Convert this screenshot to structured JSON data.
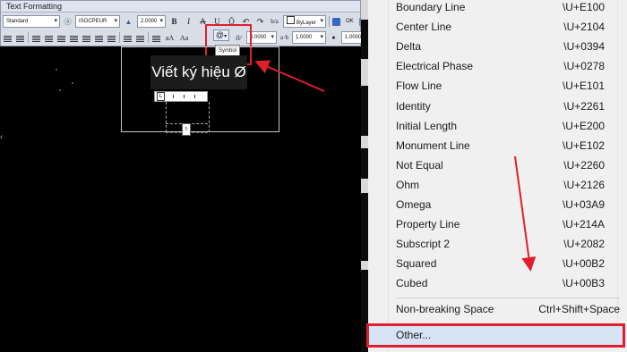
{
  "toolbar": {
    "title": "Text Formatting",
    "style": "Standard",
    "font": "ISOCPEUR",
    "height": "2.0000",
    "bold": "B",
    "italic": "I",
    "strike": "A",
    "underline": "U",
    "overline": "Ō",
    "color": "ByLayer",
    "ok": "OK",
    "symbol_glyph": "@",
    "oblique_value": "0.0000",
    "tracking_value": "1.0000",
    "width_value": "1.0000",
    "oblique_glyph": "0/",
    "tracking_glyph": "a·b",
    "width_glyph": "●"
  },
  "tooltip": "Symbol",
  "canvas": {
    "mtext": "Viết ký hiệu Ø",
    "ruler_tab": "L",
    "grip": "◊"
  },
  "menu": {
    "items": [
      {
        "label": "Boundary Line",
        "code": "\\U+E100"
      },
      {
        "label": "Center Line",
        "code": "\\U+2104"
      },
      {
        "label": "Delta",
        "code": "\\U+0394"
      },
      {
        "label": "Electrical Phase",
        "code": "\\U+0278"
      },
      {
        "label": "Flow Line",
        "code": "\\U+E101"
      },
      {
        "label": "Identity",
        "code": "\\U+2261"
      },
      {
        "label": "Initial Length",
        "code": "\\U+E200"
      },
      {
        "label": "Monument Line",
        "code": "\\U+E102"
      },
      {
        "label": "Not Equal",
        "code": "\\U+2260"
      },
      {
        "label": "Ohm",
        "code": "\\U+2126"
      },
      {
        "label": "Omega",
        "code": "\\U+03A9"
      },
      {
        "label": "Property Line",
        "code": "\\U+214A"
      },
      {
        "label": "Subscript 2",
        "code": "\\U+2082"
      },
      {
        "label": "Squared",
        "code": "\\U+00B2"
      },
      {
        "label": "Cubed",
        "code": "\\U+00B3"
      }
    ],
    "nbsp": {
      "label": "Non-breaking Space",
      "code": "Ctrl+Shift+Space"
    },
    "other": "Other..."
  },
  "colors": {
    "highlight": "#e01e2e",
    "menu_bg": "#f0f0f0",
    "selected_bg": "#d6e4f5"
  }
}
